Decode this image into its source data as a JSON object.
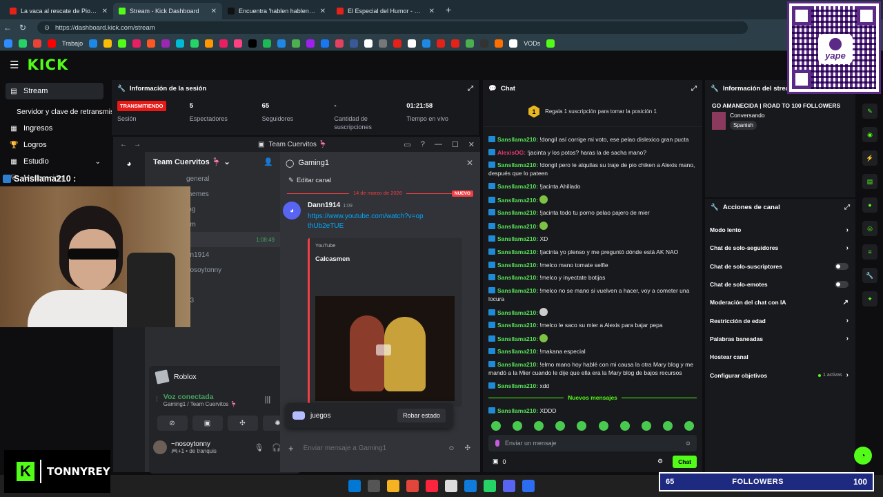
{
  "browser": {
    "tabs": [
      {
        "title": "La vaca al rescate de Pio chicken",
        "color": "#e62117",
        "active": false
      },
      {
        "title": "Stream - Kick Dashboard",
        "color": "#53fc18",
        "active": true
      },
      {
        "title": "Encuentra 'hablen hablen carajo'",
        "color": "#111111",
        "active": false
      },
      {
        "title": "El Especial del Humor - Claudio y",
        "color": "#e62117",
        "active": false
      }
    ],
    "new_tab": "+",
    "url": "https://dashboard.kick.com/stream",
    "bookmark_folder": "Trabajo",
    "bookmark_vods": "VODs"
  },
  "kick": {
    "logo": "KICK",
    "sidebar": [
      {
        "label": "Stream",
        "icon": "stream-icon",
        "active": true
      },
      {
        "label": "Servidor y clave de retransmisión",
        "icon": "",
        "sub": true
      },
      {
        "label": "Ingresos",
        "icon": "revenue-icon"
      },
      {
        "label": "Logros",
        "icon": "trophy-icon"
      },
      {
        "label": "Estudio",
        "icon": "studio-icon",
        "chevron": true
      },
      {
        "label": "Moderación",
        "icon": "shield-icon"
      }
    ],
    "session": {
      "title": "Información de la sesión",
      "live_badge": "TRANSMITIENDO",
      "stats": [
        {
          "value": "",
          "label": "Sesión"
        },
        {
          "value": "5",
          "label": "Espectadores"
        },
        {
          "value": "65",
          "label": "Seguidores"
        },
        {
          "value": "-",
          "label": "Cantidad de suscripciones"
        },
        {
          "value": "01:21:58",
          "label": "Tiempo en vivo"
        }
      ]
    },
    "chat": {
      "title": "Chat",
      "pinned_rank": "1",
      "pinned_text": "Regala 1 suscripción para tomar la posición 1",
      "messages": [
        {
          "user": "Sansllama210:",
          "text": "!dongil así corrige mi voto, ese pelao dislexico gran pucta"
        },
        {
          "user": "AlexisOG:",
          "text": "!jacinta y los potos? haras la de sacha mano?",
          "red": true
        },
        {
          "user": "Sansllama210:",
          "text": "!dongil pero le alquilas su traje de pio chiken a Alexis mano, después que lo pateen"
        },
        {
          "user": "Sansllama210:",
          "text": "!jacinta Ahillado"
        },
        {
          "user": "Sansllama210:",
          "text": "",
          "emote": "frog"
        },
        {
          "user": "Sansllama210:",
          "text": "!jacinta todo tu porno pelao pajero de mier"
        },
        {
          "user": "Sansllama210:",
          "text": "",
          "emote": "frog"
        },
        {
          "user": "Sansllama210:",
          "text": "XD"
        },
        {
          "user": "Sansllama210:",
          "text": "!jacinta yo plenso y me preguntó dónde está AK NAO"
        },
        {
          "user": "Sansllama210:",
          "text": "!melco mano tomate selfie"
        },
        {
          "user": "Sansllama210:",
          "text": "!melco y inyectate botijas"
        },
        {
          "user": "Sansllama210:",
          "text": "!melco no se mano si vuelven a hacer, voy a cometer una locura"
        },
        {
          "user": "Sansllama210:",
          "text": "",
          "emote": "skull"
        },
        {
          "user": "Sansllama210:",
          "text": "!melco le saco su mier a Alexis para bajar pepa"
        },
        {
          "user": "Sansllama210:",
          "text": "",
          "emote": "frog"
        },
        {
          "user": "Sansllama210:",
          "text": "!makana especial"
        },
        {
          "user": "Sansllama210:",
          "text": "!elmo mano hoy hablé con mi causa la otra Mary blog y me mandó a la Mier cuando le dije que ella era la Mary blog de bajos recursos"
        },
        {
          "user": "Sansllama210:",
          "text": "xdd"
        }
      ],
      "new_messages_label": "Nuevos mensajes",
      "last_message": {
        "user": "Sansllama210:",
        "text": "XDDD"
      },
      "input_placeholder": "Enviar un mensaje",
      "points": "0",
      "send_label": "Chat"
    },
    "info": {
      "title": "Información del stream",
      "stream_title": "GO AMANECIDA | ROAD TO 100 FOLLOWERS",
      "category": "Conversando",
      "language": "Spanish"
    },
    "actions": {
      "title": "Acciones de canal",
      "items": [
        {
          "label": "Modo lento",
          "control": "chevron"
        },
        {
          "label": "Chat de solo-seguidores",
          "control": "chevron"
        },
        {
          "label": "Chat de solo-suscriptores",
          "control": "toggle"
        },
        {
          "label": "Chat de solo-emotes",
          "control": "toggle"
        },
        {
          "label": "Moderación del chat con IA",
          "control": "external"
        },
        {
          "label": "Restricción de edad",
          "control": "chevron"
        },
        {
          "label": "Palabras baneadas",
          "control": "chevron"
        },
        {
          "label": "Hostear canal",
          "control": "none"
        },
        {
          "label": "Configurar objetivos",
          "control": "chevron",
          "extra": "1 activas"
        }
      ]
    }
  },
  "discord": {
    "window_title": "Team Cuervitos 🦩",
    "guild": "Team Cuervitos 🦩",
    "channels": [
      "general",
      "memes",
      "ing",
      "am",
      "1",
      "nn1914",
      "nosoytonny",
      "2",
      "g3"
    ],
    "voice_timer": "1:08:49",
    "active_channel": "Gaming1",
    "edit_channel": "Editar canal",
    "divider_date": "14 de marzo de 2026",
    "new_badge": "NUEVO",
    "message": {
      "author": "Dann1914",
      "time": "1:09",
      "link": "https://www.youtube.com/watch?v=opthUb2eTUE",
      "embed_provider": "YouTube",
      "embed_title": "Calcasmen"
    },
    "popup": {
      "label": "juegos",
      "button": "Robar estado"
    },
    "activity": "Roblox",
    "voice_status": "Voz conectada",
    "voice_channel": "Gaming1 / Team Cuervitos 🦩",
    "user_name": "~nosoytonny",
    "user_status": "🎮+1 • de tranquis",
    "input_placeholder": "Enviar mensaje a Gaming1"
  },
  "overlay": {
    "cam_username": "Sansllama210 :",
    "brand_name": "TONNYREY",
    "brand_letter": "K",
    "followers_count": "65",
    "followers_label": "FOLLOWERS",
    "followers_goal": "100",
    "qr_text": "yape"
  }
}
